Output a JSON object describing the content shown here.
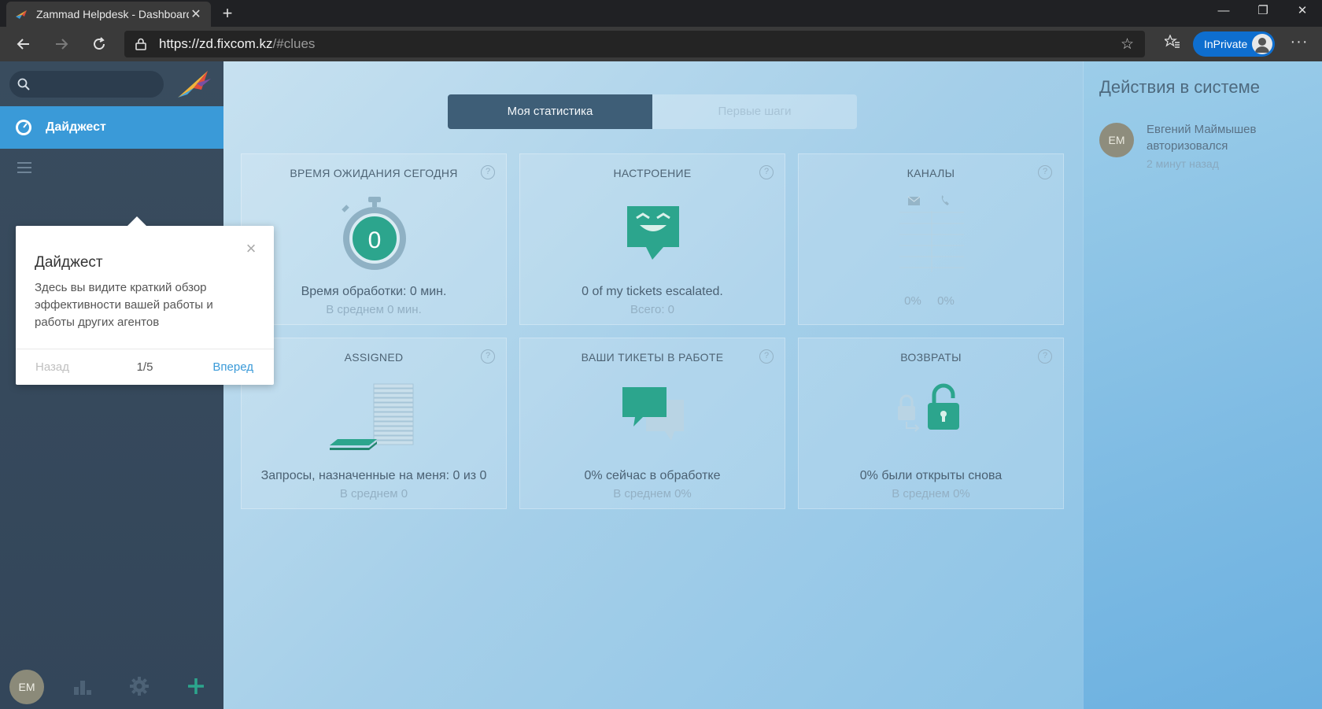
{
  "browser": {
    "tab_title": "Zammad Helpdesk - Dashboard",
    "tab_close": "✕",
    "new_tab": "+",
    "url_host": "https://zd.fixcom.kz",
    "url_path": "/#clues",
    "inprivate_label": "InPrivate",
    "more": "···",
    "minimize": "—",
    "restore": "❐",
    "close": "✕"
  },
  "sidebar": {
    "active_item": "Дайджест",
    "avatar_initials": "EM"
  },
  "dashboard": {
    "tabs": [
      {
        "label": "Моя статистика",
        "active": true
      },
      {
        "label": "Первые шаги",
        "active": false
      }
    ],
    "cards": [
      {
        "title": "ВРЕМЯ ОЖИДАНИЯ СЕГОДНЯ",
        "value": "0",
        "main": "Время обработки: 0 мин.",
        "sub": "В среднем 0 мин."
      },
      {
        "title": "НАСТРОЕНИЕ",
        "main": "0 of my tickets escalated.",
        "sub": "Всего: 0"
      },
      {
        "title": "КАНАЛЫ",
        "main": "",
        "sub": "",
        "channel_values": [
          "0%",
          "0%"
        ]
      },
      {
        "title": "ASSIGNED",
        "main": "Запросы, назначенные на меня: 0 из 0",
        "sub": "В среднем 0"
      },
      {
        "title": "ВАШИ ТИКЕТЫ В РАБОТЕ",
        "main": "0% сейчас в обработке",
        "sub": "В среднем 0%"
      },
      {
        "title": "ВОЗВРАТЫ",
        "main": "0% были открыты снова",
        "sub": "В среднем 0%"
      }
    ],
    "help": "?"
  },
  "activity": {
    "title": "Действия в системе",
    "items": [
      {
        "initials": "EM",
        "name": "Евгений Маймышев",
        "action": "авторизовался",
        "time": "2 минут назад"
      }
    ]
  },
  "popover": {
    "title": "Дайджест",
    "body": "Здесь вы видите краткий обзор эффективности вашей работы и работы других агентов",
    "back": "Назад",
    "counter": "1/5",
    "next": "Вперед",
    "close": "×"
  },
  "colors": {
    "accent": "#3a9ad8",
    "teal": "#2ca58d",
    "sidebar": "#394c5e"
  }
}
